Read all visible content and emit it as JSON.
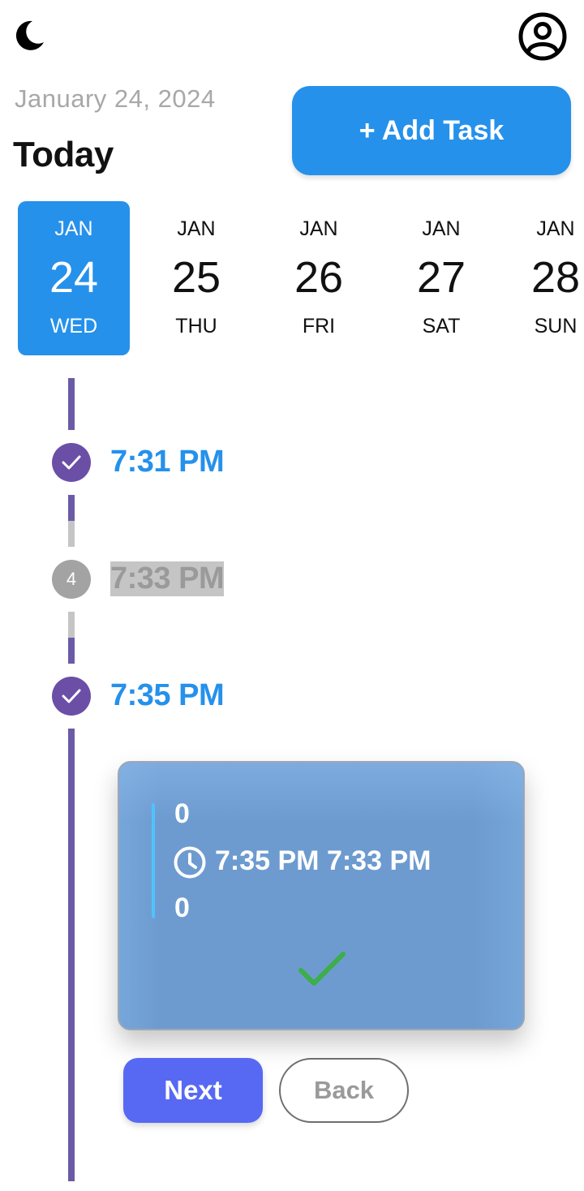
{
  "header": {
    "theme_icon": "moon-icon",
    "profile_icon": "user-circle-icon",
    "date": "January 24, 2024",
    "title": "Today",
    "add_task_label": "+ Add Task"
  },
  "date_strip": [
    {
      "month": "JAN",
      "day": "24",
      "weekday": "WED",
      "selected": true
    },
    {
      "month": "JAN",
      "day": "25",
      "weekday": "THU",
      "selected": false
    },
    {
      "month": "JAN",
      "day": "26",
      "weekday": "FRI",
      "selected": false
    },
    {
      "month": "JAN",
      "day": "27",
      "weekday": "SAT",
      "selected": false
    },
    {
      "month": "JAN",
      "day": "28",
      "weekday": "SUN",
      "selected": false
    }
  ],
  "timeline": [
    {
      "time": "7:31 PM",
      "status": "done",
      "icon": "check-icon"
    },
    {
      "time": "7:33 PM",
      "status": "pending",
      "badge": "4"
    },
    {
      "time": "7:35 PM",
      "status": "done",
      "icon": "check-icon"
    }
  ],
  "task_card": {
    "top_value": "0",
    "time_range": "7:35 PM 7:33 PM",
    "bottom_value": "0",
    "clock_icon": "clock-icon",
    "status_icon": "check-icon"
  },
  "actions": {
    "next_label": "Next",
    "back_label": "Back"
  },
  "colors": {
    "accent": "#2591eb",
    "timeline_purple": "#6b5aa6",
    "pending_grey": "#a3a3a3",
    "next_button": "#5769f3",
    "card_bg": "#6d9bd0",
    "check_green": "#3cae4a"
  }
}
